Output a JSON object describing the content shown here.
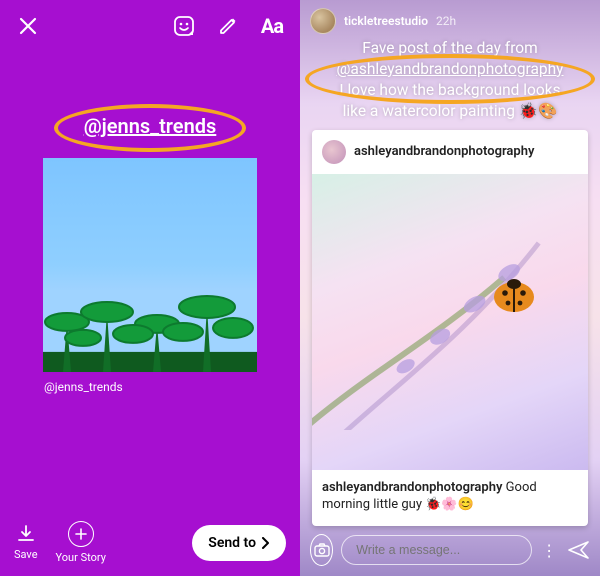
{
  "colors": {
    "accent": "#a60fd0",
    "highlight": "#f5a623"
  },
  "left": {
    "mention": "@jenns_trends",
    "tile_caption": "@jenns_trends",
    "save_label": "Save",
    "your_story_label": "Your Story",
    "send_to_label": "Send to",
    "text_tool_label": "Aa"
  },
  "right": {
    "header": {
      "username": "tickletreestudio",
      "time": "22h"
    },
    "caption": {
      "line1": "Fave post of the day from",
      "mention": "@ashleyandbrandonphotography",
      "line3": "I love how the background looks",
      "line4": "like a watercolor painting 🐞🎨"
    },
    "card": {
      "username": "ashleyandbrandonphotography",
      "caption_user": "ashleyandbrandonphotography",
      "caption_text": "Good morning little guy 🐞🌸😊"
    },
    "footer": {
      "placeholder": "Write a message..."
    }
  }
}
